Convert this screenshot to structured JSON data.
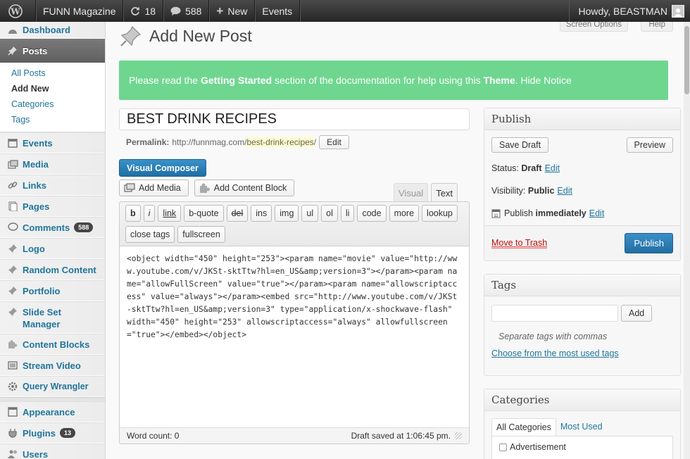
{
  "adminbar": {
    "site_name": "FUNN Magazine",
    "updates_count": "18",
    "comments_count": "588",
    "new_label": "New",
    "events_label": "Events",
    "howdy": "Howdy, BEASTMAN"
  },
  "sidebar": {
    "dashboard": "Dashboard",
    "posts": "Posts",
    "posts_sub": [
      "All Posts",
      "Add New",
      "Categories",
      "Tags"
    ],
    "items": [
      {
        "label": "Events"
      },
      {
        "label": "Media"
      },
      {
        "label": "Links"
      },
      {
        "label": "Pages"
      },
      {
        "label": "Comments",
        "badge": "588"
      },
      {
        "label": "Logo"
      },
      {
        "label": "Random Content"
      },
      {
        "label": "Portfolio"
      },
      {
        "label": "Slide Set Manager"
      },
      {
        "label": "Content Blocks"
      },
      {
        "label": "Stream Video"
      },
      {
        "label": "Query Wrangler"
      }
    ],
    "appearance": "Appearance",
    "plugins": "Plugins",
    "plugins_badge": "13",
    "users": "Users"
  },
  "header": {
    "title": "Add New Post",
    "screen_options": "Screen Options",
    "help": "Help"
  },
  "notice": {
    "pre": "Please read the ",
    "b1": "Getting Started",
    "mid": " section of the documentation for help using this ",
    "b2": "Theme",
    "post": ". Hide Notice"
  },
  "post": {
    "title": "BEST DRINK RECIPES",
    "permalink_label": "Permalink:",
    "permalink_base": "http://funnmag.com/",
    "permalink_slug": "best-drink-recipes",
    "permalink_end": "/",
    "permalink_edit": "Edit"
  },
  "editor": {
    "visual_composer": "Visual Composer",
    "add_media": "Add Media",
    "add_content_block": "Add Content Block",
    "tab_visual": "Visual",
    "tab_text": "Text",
    "quicktags": [
      "b",
      "i",
      "link",
      "b-quote",
      "del",
      "ins",
      "img",
      "ul",
      "ol",
      "li",
      "code",
      "more",
      "lookup",
      "close tags",
      "fullscreen"
    ],
    "content": "<object width=\"450\" height=\"253\"><param name=\"movie\" value=\"http://www.youtube.com/v/JKSt-sktTtw?hl=en_US&amp;version=3\"></param><param name=\"allowFullScreen\" value=\"true\"></param><param name=\"allowscriptaccess\" value=\"always\"></param><embed src=\"http://www.youtube.com/v/JKSt-sktTtw?hl=en_US&amp;version=3\" type=\"application/x-shockwave-flash\" width=\"450\" height=\"253\" allowscriptaccess=\"always\" allowfullscreen=\"true\"></embed></object>",
    "word_count": "Word count: 0",
    "draft_saved": "Draft saved at 1:06:45 pm."
  },
  "publish": {
    "title": "Publish",
    "save_draft": "Save Draft",
    "preview": "Preview",
    "status_label": "Status:",
    "status_value": "Draft",
    "visibility_label": "Visibility:",
    "visibility_value": "Public",
    "publish_label": "Publish",
    "publish_value": "immediately",
    "edit": "Edit",
    "move_to_trash": "Move to Trash",
    "publish_button": "Publish"
  },
  "tags": {
    "title": "Tags",
    "add": "Add",
    "hint": "Separate tags with commas",
    "choose": "Choose from the most used tags"
  },
  "categories": {
    "title": "Categories",
    "tab_all": "All Categories",
    "tab_most": "Most Used",
    "first": "Advertisement"
  }
}
